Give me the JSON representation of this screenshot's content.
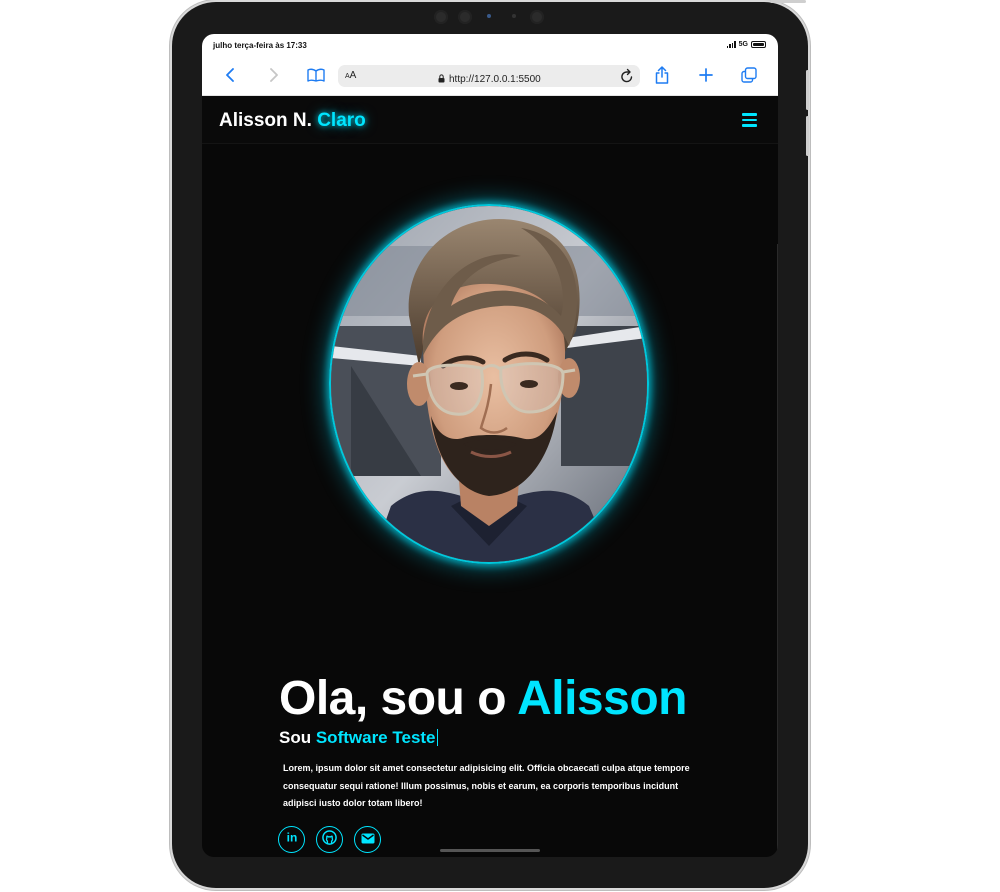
{
  "status": {
    "time": "julho terça-feira às 17:33",
    "network": "5G"
  },
  "browser": {
    "text_size": "AA",
    "url": "http://127.0.0.1:5500"
  },
  "nav": {
    "brand_first": "Alisson N.",
    "brand_accent": "Claro"
  },
  "hero": {
    "greeting": "Ola, sou o",
    "name": "Alisson",
    "sub_prefix": "Sou",
    "role": "Software Teste",
    "description": "Lorem, ipsum dolor sit amet consectetur adipisicing elit. Officia obcaecati culpa atque tempore consequatur sequi ratione! Illum possimus, nobis et earum, ea corporis temporibus incidunt adipisci iusto dolor totam libero!"
  },
  "socials": [
    {
      "icon": "linkedin-icon"
    },
    {
      "icon": "github-icon"
    },
    {
      "icon": "email-icon"
    }
  ],
  "colors": {
    "accent": "#00e5ff",
    "background": "#080808",
    "text": "#ffffff"
  }
}
